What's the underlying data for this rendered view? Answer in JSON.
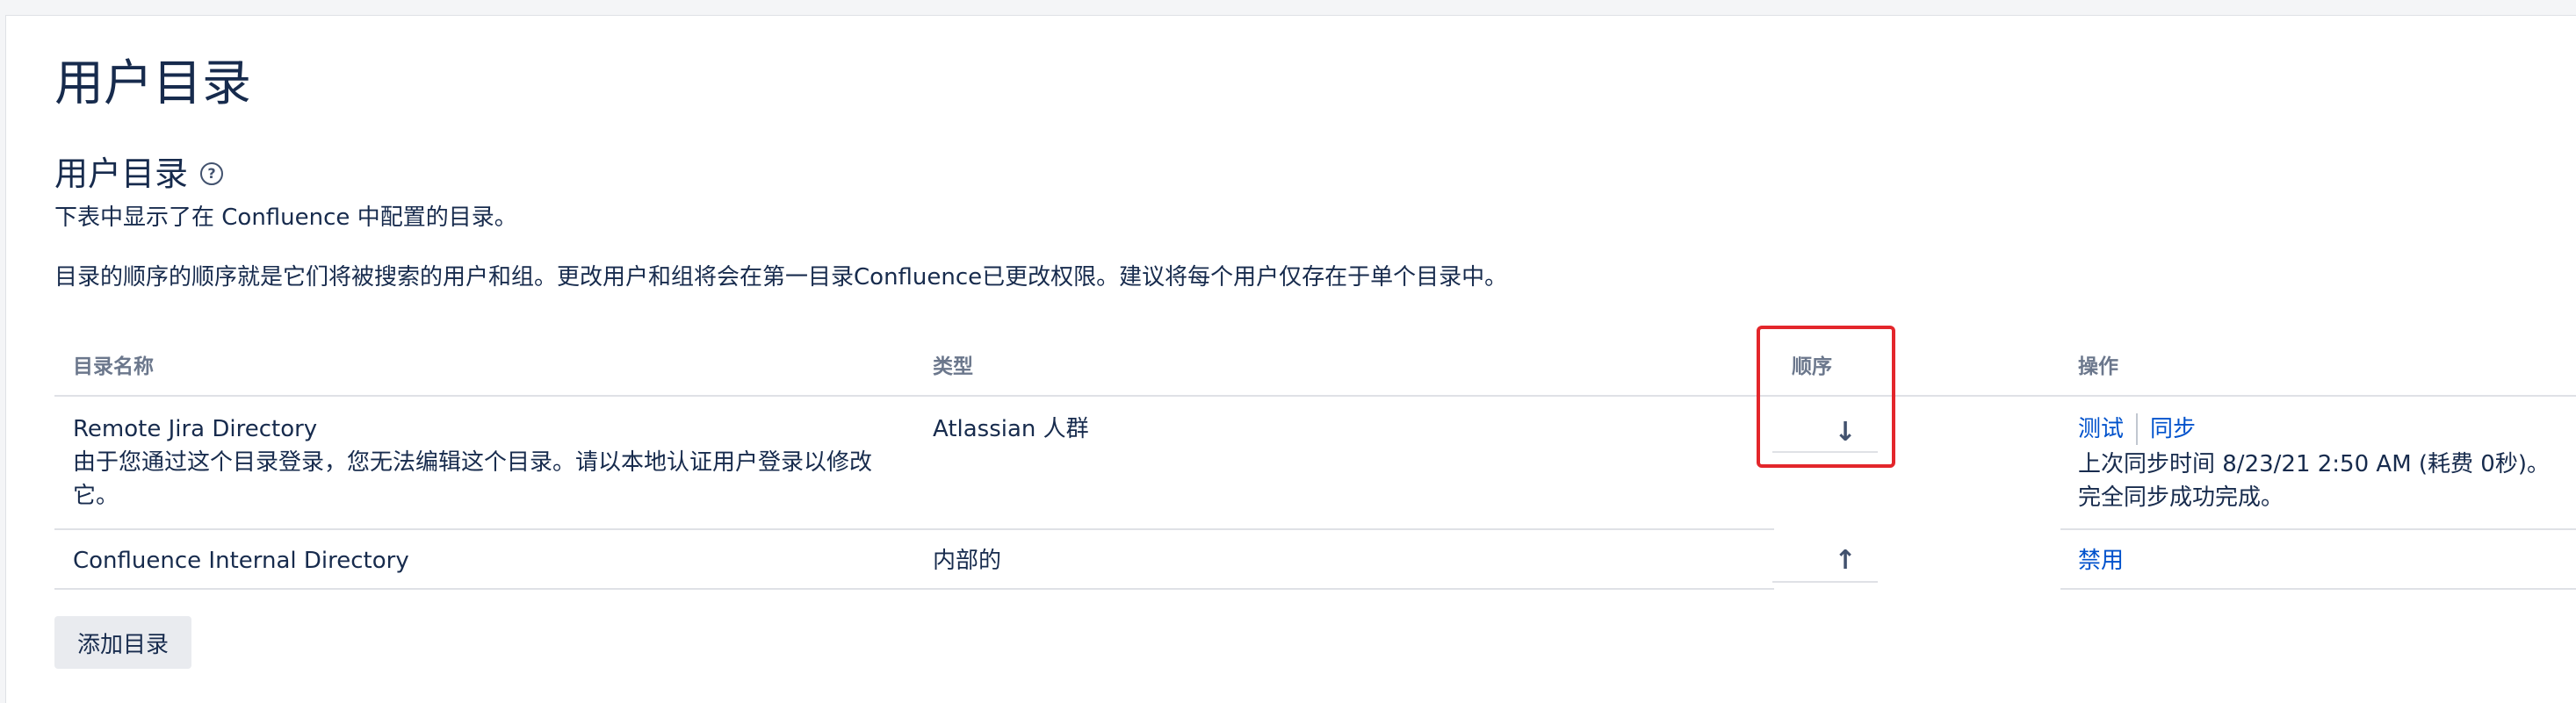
{
  "page": {
    "title": "用户目录",
    "section_title": "用户目录",
    "help_icon": "question-circle-icon",
    "description_1": "下表中显示了在 Confluence 中配置的目录。",
    "description_2": "目录的顺序的顺序就是它们将被搜索的用户和组。更改用户和组将会在第一目录Confluence已更改权限。建议将每个用户仅存在于单个目录中。"
  },
  "table": {
    "headers": {
      "name": "目录名称",
      "type": "类型",
      "order": "顺序",
      "operations": "操作"
    },
    "rows": [
      {
        "name": "Remote Jira Directory",
        "note": "由于您通过这个目录登录，您无法编辑这个目录。请以本地认证用户登录以修改它。",
        "type": "Atlassian 人群",
        "order_icon": "arrow-down-icon",
        "order_glyph": "↓",
        "actions": [
          "测试",
          "同步"
        ],
        "sync_status_1": "上次同步时间 8/23/21 2:50 AM (耗费 0秒)。",
        "sync_status_2": "完全同步成功完成。"
      },
      {
        "name": "Confluence Internal Directory",
        "type": "内部的",
        "order_icon": "arrow-up-icon",
        "order_glyph": "↑",
        "actions": [
          "禁用"
        ]
      }
    ]
  },
  "add_button_label": "添加目录",
  "colors": {
    "link": "#0052cc",
    "text": "#172b4d",
    "header": "#6b778c",
    "highlight": "#e3262b"
  }
}
